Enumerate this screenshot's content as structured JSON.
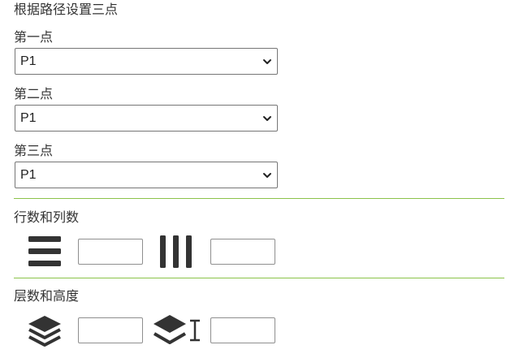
{
  "section_title": "根据路径设置三点",
  "points": [
    {
      "label": "第一点",
      "value": "P1"
    },
    {
      "label": "第二点",
      "value": "P1"
    },
    {
      "label": "第三点",
      "value": "P1"
    }
  ],
  "rows_cols": {
    "label": "行数和列数",
    "rows_value": "",
    "cols_value": "",
    "rows_icon": "rows-icon",
    "cols_icon": "columns-icon"
  },
  "layers_height": {
    "label": "层数和高度",
    "layers_value": "",
    "height_value": "",
    "layers_icon": "layers-icon",
    "height_icon": "layer-height-icon"
  },
  "colors": {
    "divider": "#8bc34a",
    "icon": "#333333"
  }
}
